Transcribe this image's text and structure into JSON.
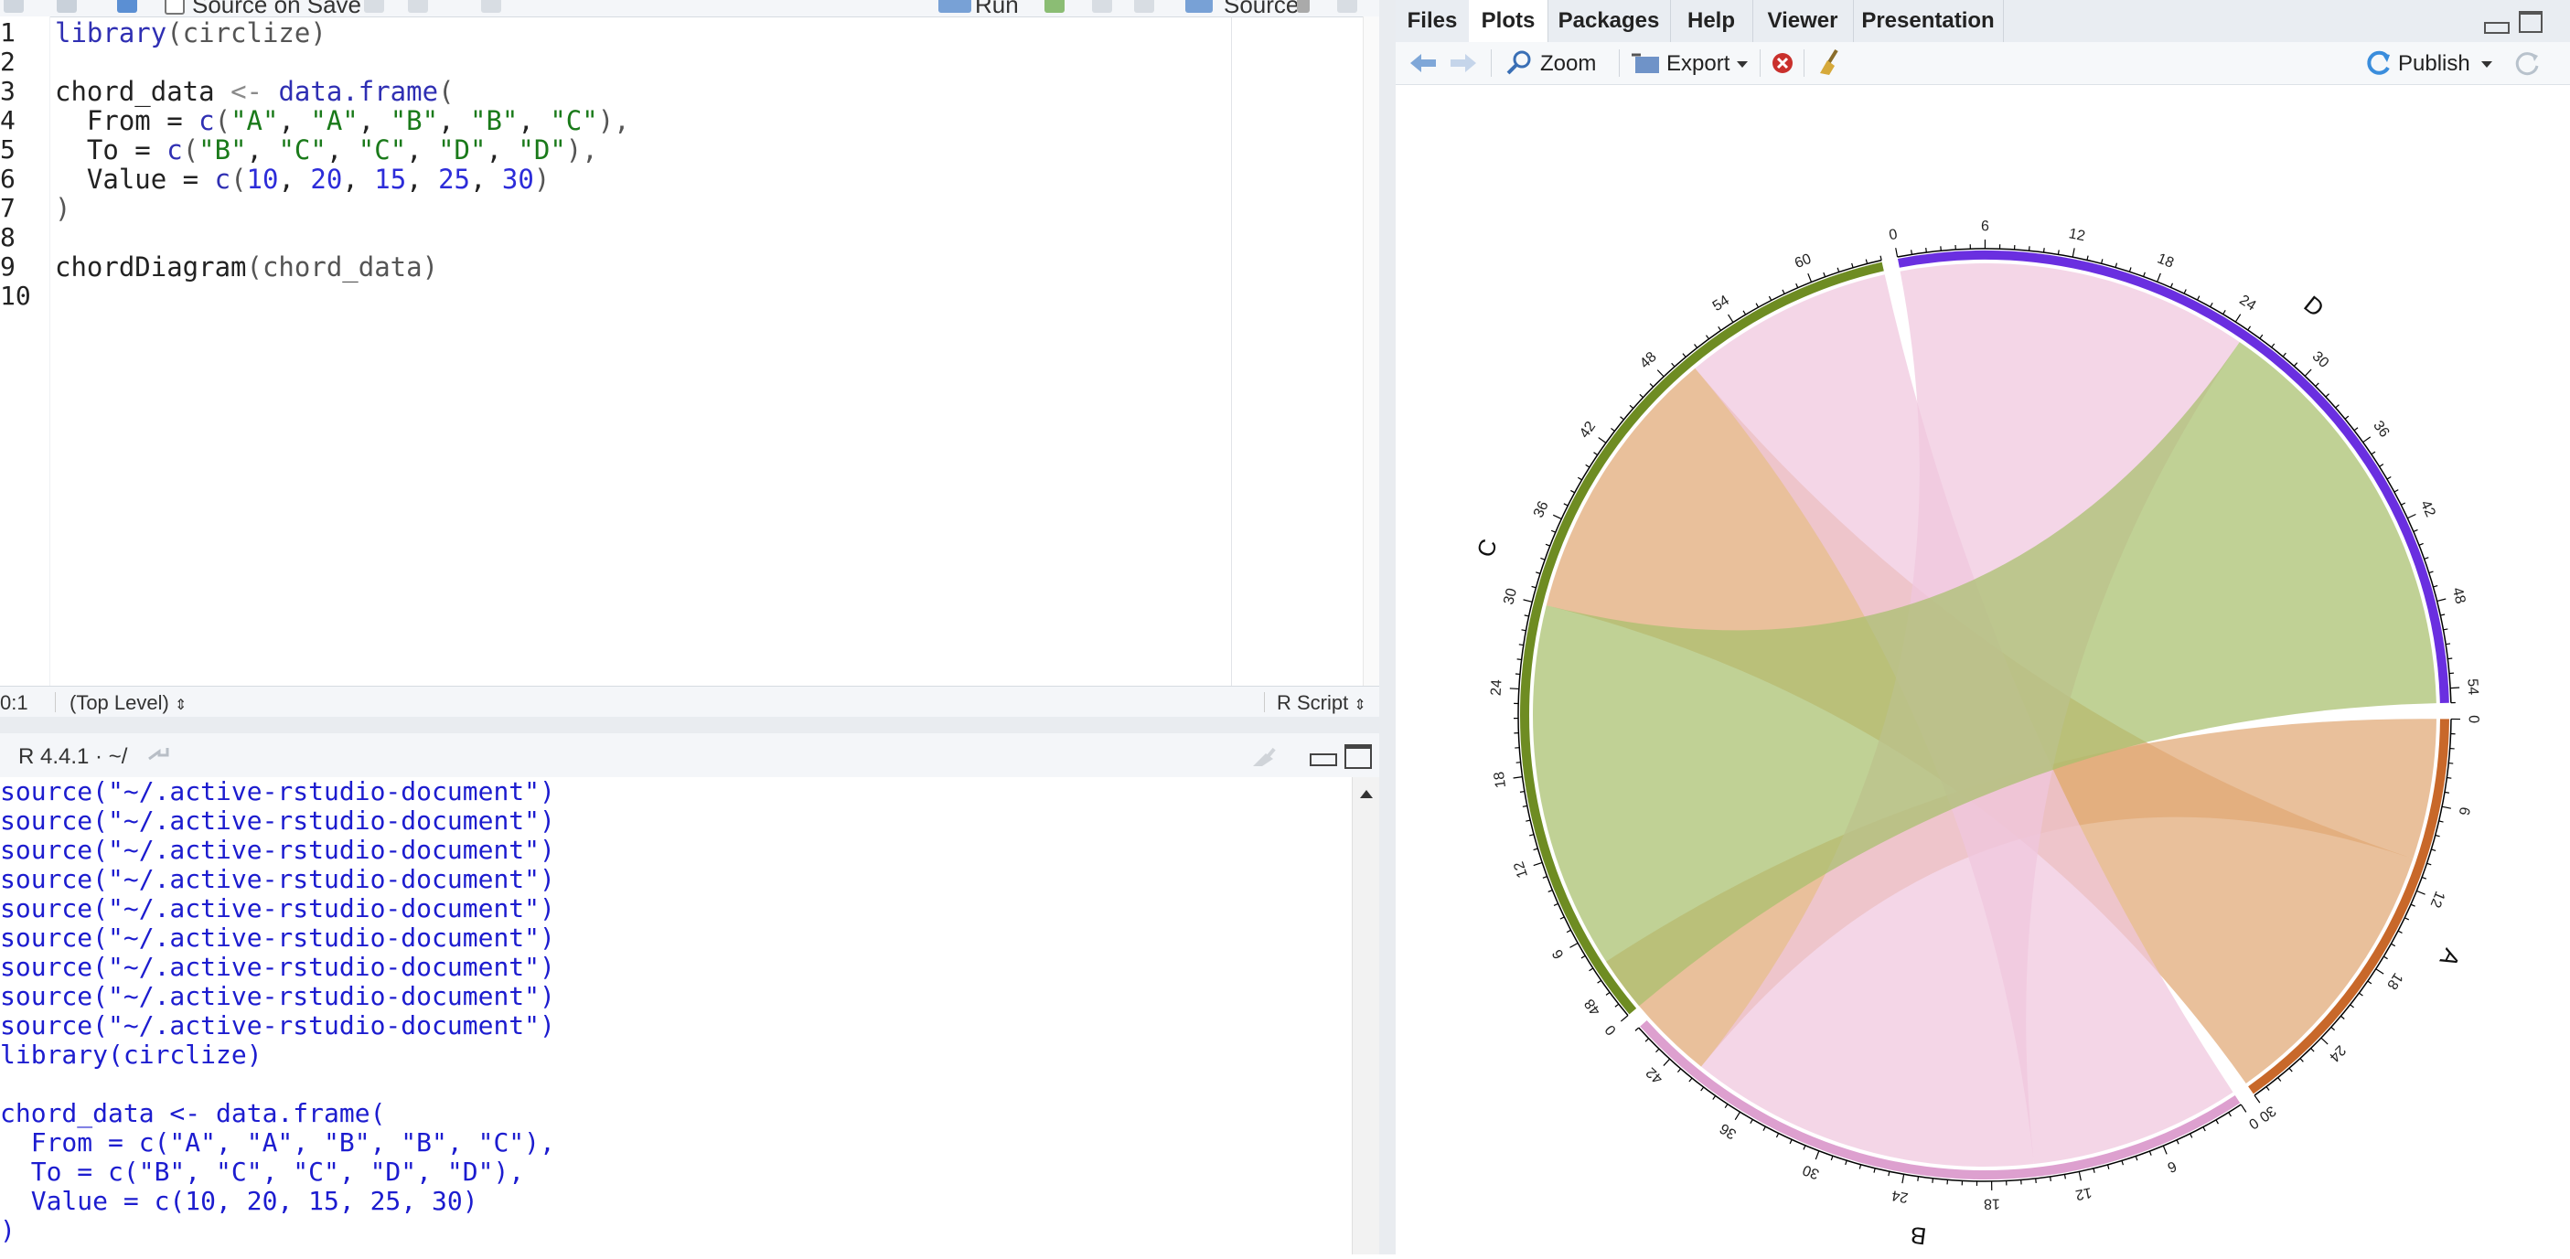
{
  "editor": {
    "toolbar": {
      "source_on_save": "Source on Save",
      "run": "Run",
      "source": "Source"
    },
    "line_numbers": [
      "1",
      "2",
      "3",
      "4",
      "5",
      "6",
      "7",
      "8",
      "9",
      "10"
    ],
    "code": {
      "l1": [
        "library",
        "(circlize)"
      ],
      "l3": [
        "chord_data",
        " <- ",
        "data.frame",
        "("
      ],
      "l4": [
        "  From = ",
        "c",
        "(",
        "\"A\"",
        ", ",
        "\"A\"",
        ", ",
        "\"B\"",
        ", ",
        "\"B\"",
        ", ",
        "\"C\"",
        "),"
      ],
      "l5": [
        "  To = ",
        "c",
        "(",
        "\"B\"",
        ", ",
        "\"C\"",
        ", ",
        "\"C\"",
        ", ",
        "\"D\"",
        ", ",
        "\"D\"",
        "),"
      ],
      "l6": [
        "  Value = ",
        "c",
        "(",
        "10",
        ", ",
        "20",
        ", ",
        "15",
        ", ",
        "25",
        ", ",
        "30",
        ")"
      ],
      "l7": ")",
      "l9": [
        "chordDiagram",
        "(chord_data)"
      ]
    },
    "status": {
      "position": "0:1",
      "scope": "(Top Level)",
      "file_type": "R Script"
    }
  },
  "console": {
    "version": "R 4.4.1 · ~/",
    "lines": [
      "source(\"~/.active-rstudio-document\")",
      "source(\"~/.active-rstudio-document\")",
      "source(\"~/.active-rstudio-document\")",
      "source(\"~/.active-rstudio-document\")",
      "source(\"~/.active-rstudio-document\")",
      "source(\"~/.active-rstudio-document\")",
      "source(\"~/.active-rstudio-document\")",
      "source(\"~/.active-rstudio-document\")",
      "source(\"~/.active-rstudio-document\")",
      "library(circlize)",
      "",
      "chord_data <- data.frame(",
      "  From = c(\"A\", \"A\", \"B\", \"B\", \"C\"),",
      "  To = c(\"B\", \"C\", \"C\", \"D\", \"D\"),",
      "  Value = c(10, 20, 15, 25, 30)",
      ")"
    ]
  },
  "right_pane": {
    "tabs": [
      "Files",
      "Plots",
      "Packages",
      "Help",
      "Viewer",
      "Presentation"
    ],
    "active_tab": "Plots",
    "toolbar": {
      "zoom": "Zoom",
      "export": "Export",
      "publish": "Publish"
    }
  },
  "chart_data": {
    "type": "chord",
    "sectors": [
      {
        "name": "A",
        "total": 30,
        "color": "#c8682a",
        "ticks": [
          "0",
          "6",
          "12",
          "18",
          "24",
          "30"
        ]
      },
      {
        "name": "B",
        "total": 45,
        "color": "#dda0cf",
        "ticks": [
          "0",
          "6",
          "12",
          "18",
          "24",
          "30",
          "36",
          "42",
          "48"
        ]
      },
      {
        "name": "C",
        "total": 65,
        "color": "#6e8c22",
        "ticks": [
          "0",
          "6",
          "12",
          "18",
          "24",
          "30",
          "36",
          "42",
          "48",
          "54",
          "60"
        ]
      },
      {
        "name": "D",
        "total": 55,
        "color": "#6a2fe0",
        "ticks": [
          "0",
          "6",
          "12",
          "18",
          "24",
          "30",
          "36",
          "42",
          "48",
          "54"
        ]
      }
    ],
    "links": [
      {
        "from": "A",
        "to": "B",
        "value": 10,
        "color": "#e1a874"
      },
      {
        "from": "A",
        "to": "C",
        "value": 20,
        "color": "#e1a874"
      },
      {
        "from": "B",
        "to": "C",
        "value": 15,
        "color": "#f0c6de"
      },
      {
        "from": "B",
        "to": "D",
        "value": 25,
        "color": "#f0c6de"
      },
      {
        "from": "C",
        "to": "D",
        "value": 30,
        "color": "#a8bf6c"
      }
    ]
  }
}
